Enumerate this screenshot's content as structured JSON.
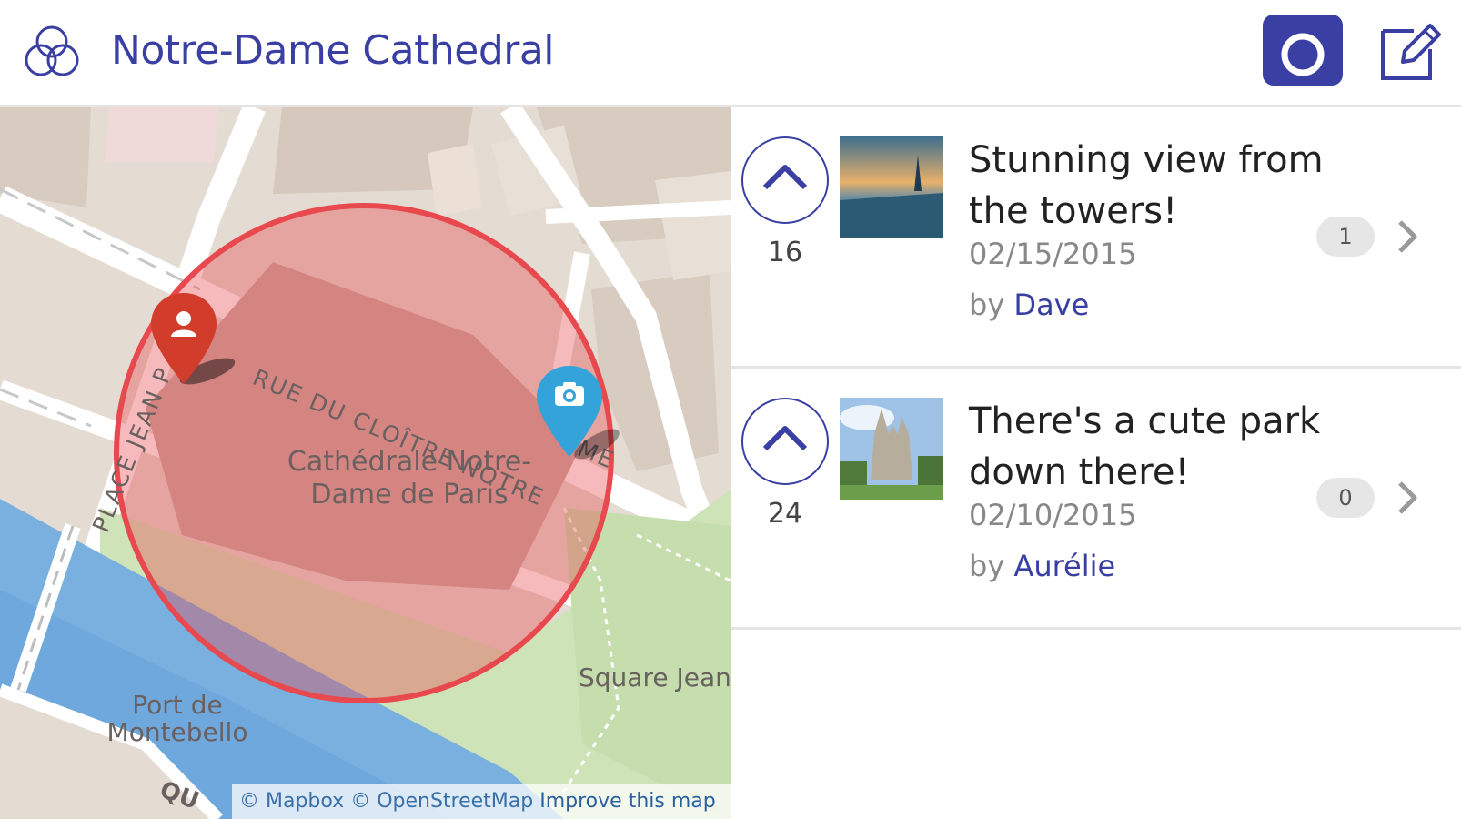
{
  "header": {
    "title": "Notre-Dame Cathedral",
    "logo_icon": "three-circles-logo-icon",
    "camera_icon": "camera-icon",
    "edit_icon": "edit-icon",
    "accent_color": "#3a3fa3"
  },
  "map": {
    "labels": {
      "street_cloitre": "RUE DU CLOÎTRE NOTRE",
      "street_cloitre_tail": "ME",
      "place_jean": "PLACE JEAN P",
      "cathedral_line1": "Cathédrale Notre-",
      "cathedral_line2": "Dame de Paris",
      "square": "Square Jean",
      "port_line1": "Port de",
      "port_line2": "Montebello",
      "quai": "QU"
    },
    "markers": {
      "user": "user-marker-icon",
      "photo": "camera-marker-icon"
    },
    "attribution": {
      "mapbox": "© Mapbox",
      "osm": "© OpenStreetMap",
      "improve": "Improve this map"
    },
    "radius_color": "#e8494e"
  },
  "posts": [
    {
      "votes": "16",
      "title": "Stunning view from the towers!",
      "date": "02/15/2015",
      "by": "by",
      "author": "Dave",
      "comments": "1"
    },
    {
      "votes": "24",
      "title": "There's a cute park down there!",
      "date": "02/10/2015",
      "by": "by",
      "author": "Aurélie",
      "comments": "0"
    }
  ]
}
